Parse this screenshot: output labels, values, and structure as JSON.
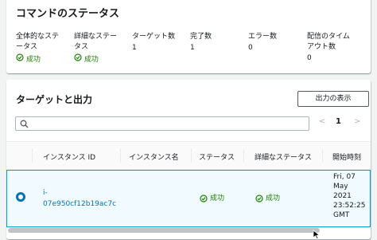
{
  "status_panel": {
    "title": "コマンドのステータス",
    "stats": [
      {
        "label": "全体的なステータス",
        "value": "成功",
        "ok": true
      },
      {
        "label": "詳細なステータス",
        "value": "成功",
        "ok": true
      },
      {
        "label": "ターゲット数",
        "value": "1"
      },
      {
        "label": "完了数",
        "value": "1"
      },
      {
        "label": "エラー数",
        "value": "0"
      },
      {
        "label": "配信のタイムアウト数",
        "value": "0"
      }
    ]
  },
  "targets_panel": {
    "title": "ターゲットと出力",
    "output_button": "出力の表示",
    "search_placeholder": "",
    "pagination": {
      "prev": "<",
      "page": "1",
      "next": ">"
    },
    "columns": [
      "インスタンス ID",
      "インスタンス名",
      "ステータス",
      "詳細なステータス",
      "開始時刻"
    ],
    "rows": [
      {
        "instance_id": "i-07e950cf12b19ac7c",
        "instance_name": "",
        "status": "成功",
        "detailed_status": "成功",
        "start_time": [
          "Fri, 07",
          "May",
          "2021",
          "23:52:25",
          "GMT"
        ]
      }
    ]
  },
  "colors": {
    "success": "#1d8102",
    "link": "#0073bb",
    "selection_border": "#00a1c9"
  }
}
